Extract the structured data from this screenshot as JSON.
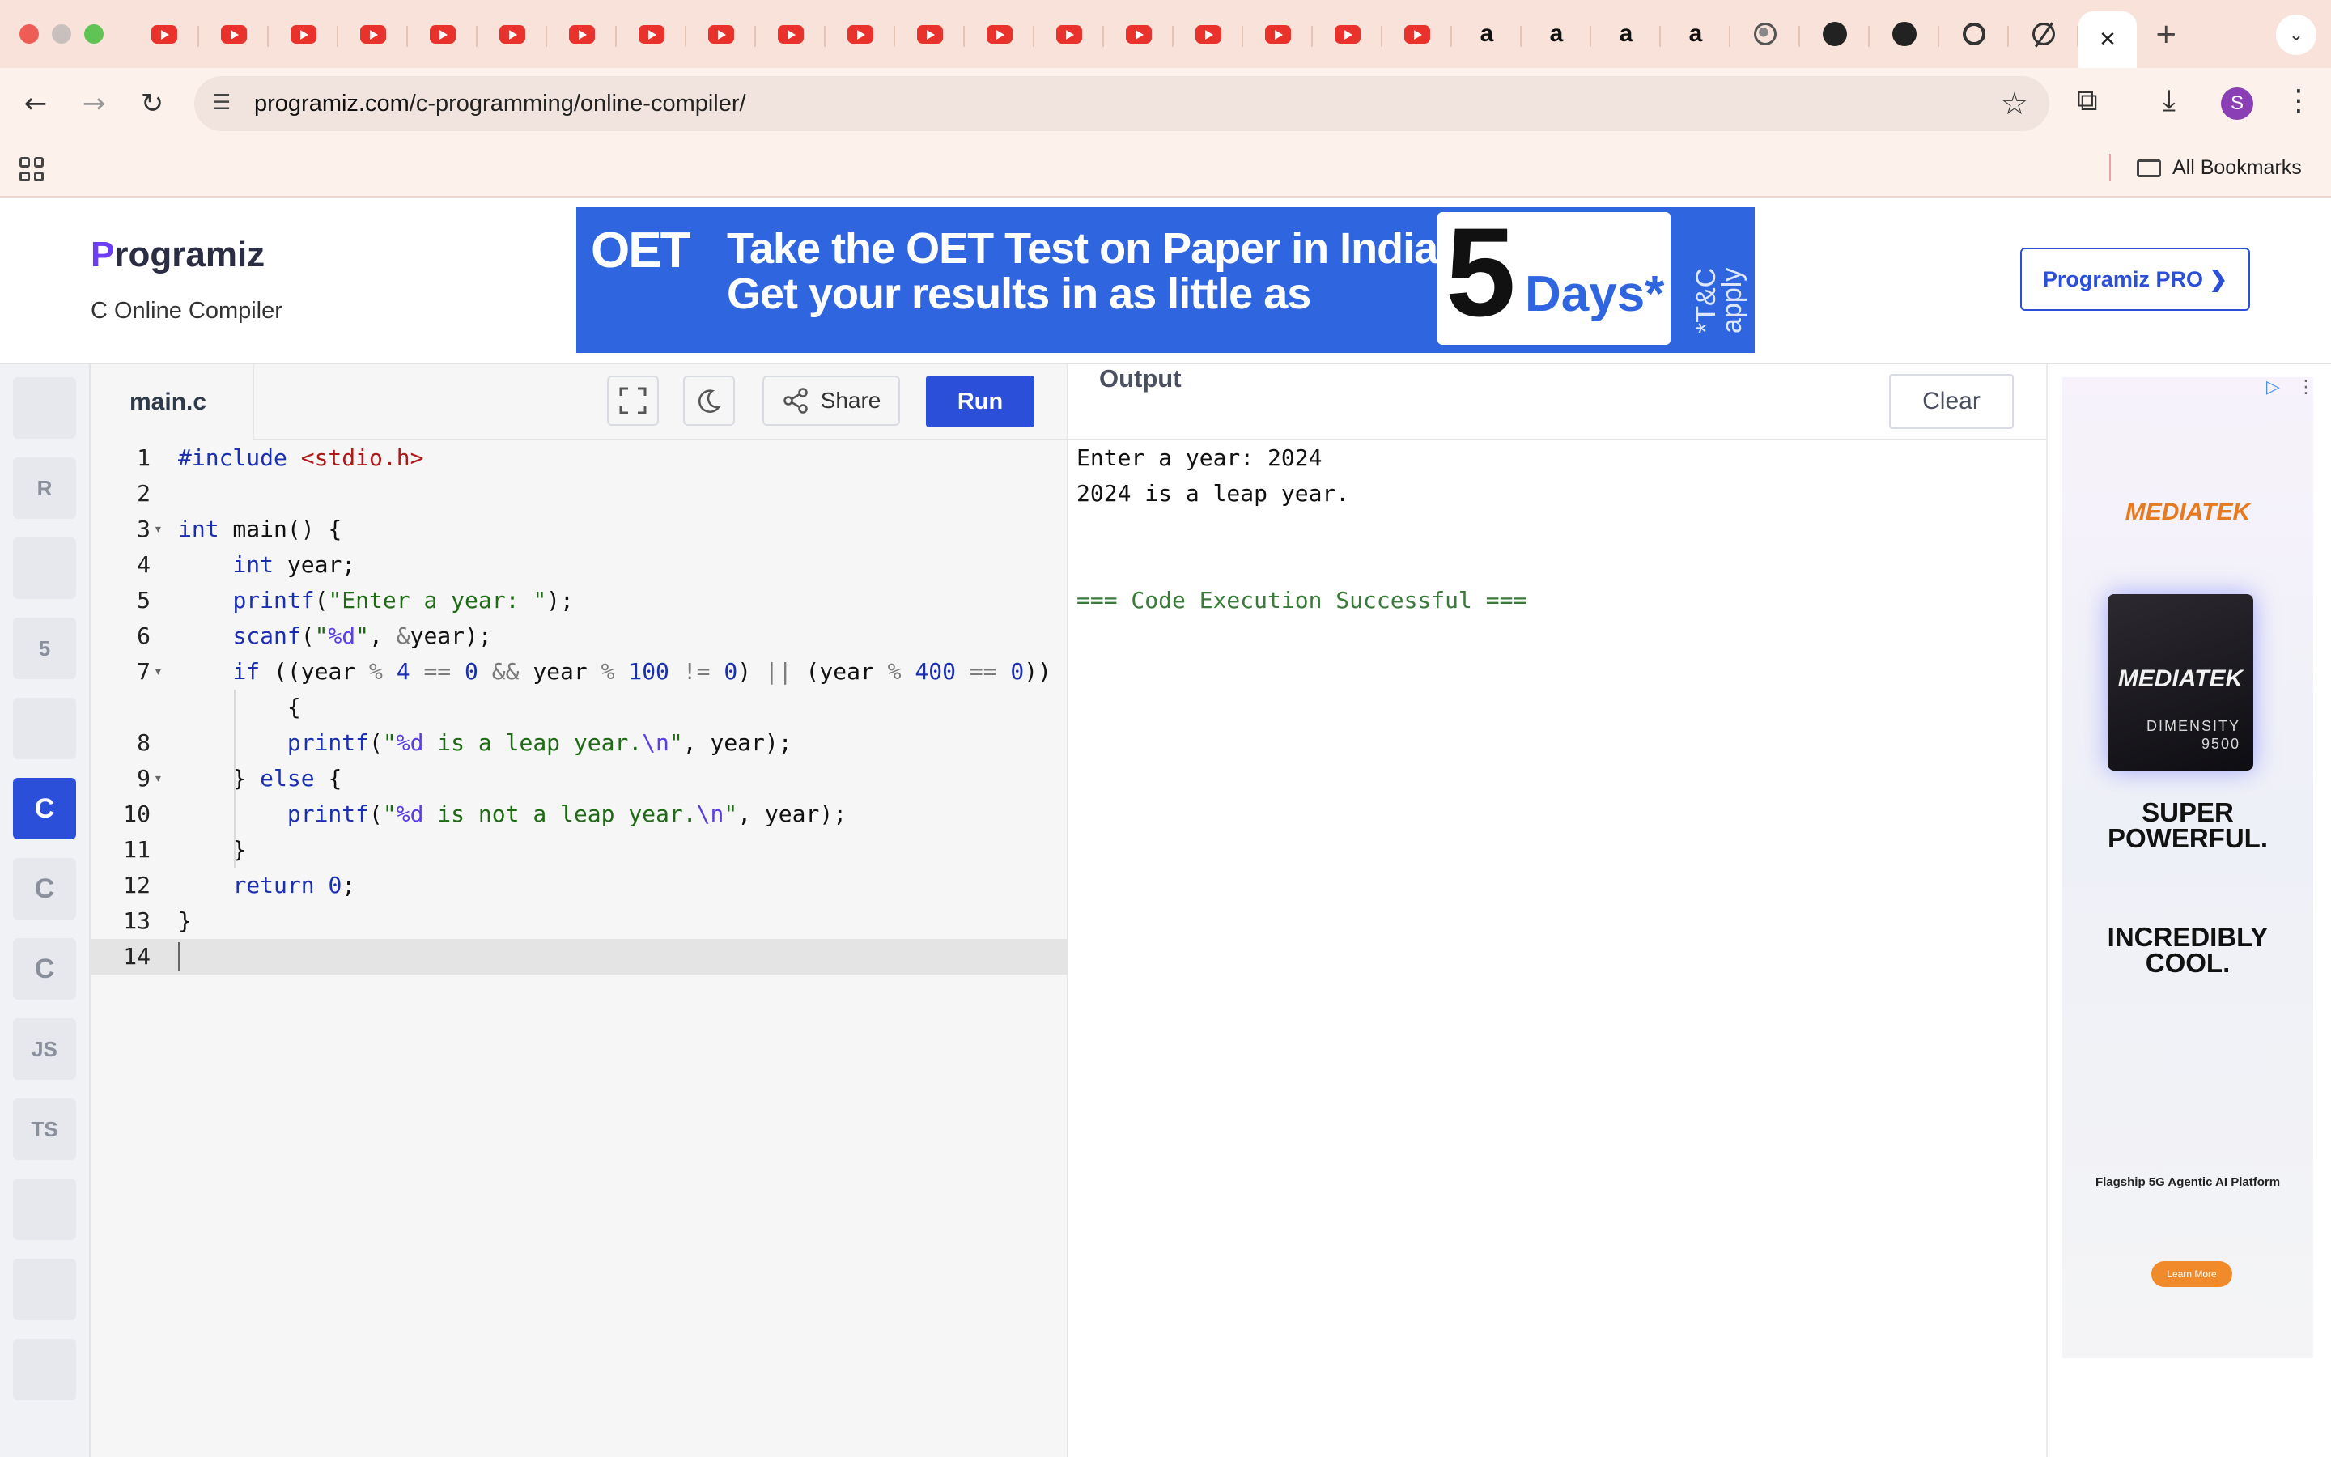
{
  "browser": {
    "tabs": [
      {
        "icon": "youtube-icon"
      },
      {
        "icon": "youtube-icon"
      },
      {
        "icon": "youtube-icon"
      },
      {
        "icon": "youtube-icon"
      },
      {
        "icon": "youtube-icon"
      },
      {
        "icon": "youtube-icon"
      },
      {
        "icon": "youtube-icon"
      },
      {
        "icon": "youtube-icon"
      },
      {
        "icon": "youtube-icon"
      },
      {
        "icon": "youtube-icon"
      },
      {
        "icon": "youtube-icon"
      },
      {
        "icon": "youtube-icon"
      },
      {
        "icon": "youtube-icon"
      },
      {
        "icon": "youtube-icon"
      },
      {
        "icon": "youtube-icon"
      },
      {
        "icon": "youtube-icon"
      },
      {
        "icon": "youtube-icon"
      },
      {
        "icon": "youtube-icon"
      },
      {
        "icon": "youtube-icon"
      },
      {
        "icon": "amazon-icon",
        "label": "a"
      },
      {
        "icon": "amazon-icon",
        "label": "a"
      },
      {
        "icon": "amazon-icon",
        "label": "a"
      },
      {
        "icon": "amazon-icon",
        "label": "a"
      },
      {
        "icon": "globe-icon"
      },
      {
        "icon": "github-icon"
      },
      {
        "icon": "github-icon"
      },
      {
        "icon": "chatgpt-icon"
      },
      {
        "icon": "perplexity-icon"
      }
    ],
    "active_tab_close": "✕",
    "new_tab": "+",
    "tab_menu": "⌄",
    "url_host": "programiz.com",
    "url_path": "/c-programming/online-compiler/",
    "back": "←",
    "forward": "→",
    "reload": "↻",
    "profile_initial": "S",
    "all_bookmarks": "All Bookmarks"
  },
  "header": {
    "logo_p": "P",
    "logo_rest": "rogramiz",
    "subtitle": "C Online Compiler",
    "pro_button": "Programiz PRO ❯"
  },
  "banner_ad": {
    "brand": "OET",
    "line1": "Take the OET Test on Paper in India.",
    "line2": "Get your results in as little as",
    "big_number": "5",
    "days": "Days*",
    "terms": "*T&C apply"
  },
  "languages": [
    {
      "name": "python",
      "label": ""
    },
    {
      "name": "r",
      "label": "R"
    },
    {
      "name": "sql",
      "label": ""
    },
    {
      "name": "html",
      "label": "5"
    },
    {
      "name": "java",
      "label": ""
    },
    {
      "name": "c",
      "label": "C",
      "active": true
    },
    {
      "name": "cpp",
      "label": "C"
    },
    {
      "name": "csharp",
      "label": "C"
    },
    {
      "name": "javascript",
      "label": "JS"
    },
    {
      "name": "typescript",
      "label": "TS"
    },
    {
      "name": "go",
      "label": ""
    },
    {
      "name": "swift",
      "label": ""
    },
    {
      "name": "rust",
      "label": ""
    }
  ],
  "editor": {
    "filename": "main.c",
    "share_label": "Share",
    "run_label": "Run",
    "lines": [
      {
        "n": "1",
        "fold": false
      },
      {
        "n": "2",
        "fold": false
      },
      {
        "n": "3",
        "fold": true
      },
      {
        "n": "4",
        "fold": false
      },
      {
        "n": "5",
        "fold": false
      },
      {
        "n": "6",
        "fold": false
      },
      {
        "n": "7",
        "fold": true
      },
      {
        "n": "",
        "fold": false
      },
      {
        "n": "8",
        "fold": false
      },
      {
        "n": "9",
        "fold": true
      },
      {
        "n": "10",
        "fold": false
      },
      {
        "n": "11",
        "fold": false
      },
      {
        "n": "12",
        "fold": false
      },
      {
        "n": "13",
        "fold": false
      },
      {
        "n": "14",
        "fold": false,
        "current": true
      }
    ],
    "code_tokens": [
      [
        [
          "k",
          "#include "
        ],
        [
          "inc",
          "<stdio.h>"
        ]
      ],
      [],
      [
        [
          "k",
          "int"
        ],
        [
          "t",
          " main() {"
        ]
      ],
      [
        [
          "t",
          "    "
        ],
        [
          "k",
          "int"
        ],
        [
          "t",
          " year;"
        ]
      ],
      [
        [
          "t",
          "    "
        ],
        [
          "k",
          "printf"
        ],
        [
          "t",
          "("
        ],
        [
          "s",
          "\"Enter a year: \""
        ],
        [
          "t",
          ");"
        ]
      ],
      [
        [
          "t",
          "    "
        ],
        [
          "k",
          "scanf"
        ],
        [
          "t",
          "("
        ],
        [
          "s",
          "\""
        ],
        [
          "e",
          "%d"
        ],
        [
          "s",
          "\""
        ],
        [
          "t",
          ", "
        ],
        [
          "op",
          "&"
        ],
        [
          "t",
          "year);"
        ]
      ],
      [
        [
          "t",
          "    "
        ],
        [
          "k",
          "if"
        ],
        [
          "t",
          " ((year "
        ],
        [
          "op",
          "%"
        ],
        [
          "t",
          " "
        ],
        [
          "num",
          "4"
        ],
        [
          "t",
          " "
        ],
        [
          "op",
          "=="
        ],
        [
          "t",
          " "
        ],
        [
          "num",
          "0"
        ],
        [
          "t",
          " "
        ],
        [
          "op",
          "&&"
        ],
        [
          "t",
          " year "
        ],
        [
          "op",
          "%"
        ],
        [
          "t",
          " "
        ],
        [
          "num",
          "100"
        ],
        [
          "t",
          " "
        ],
        [
          "op",
          "!="
        ],
        [
          "t",
          " "
        ],
        [
          "num",
          "0"
        ],
        [
          "t",
          ") "
        ],
        [
          "op",
          "||"
        ],
        [
          "t",
          " (year "
        ],
        [
          "op",
          "%"
        ],
        [
          "t",
          " "
        ],
        [
          "num",
          "400"
        ],
        [
          "t",
          " "
        ],
        [
          "op",
          "=="
        ],
        [
          "t",
          " "
        ],
        [
          "num",
          "0"
        ],
        [
          "t",
          "))"
        ]
      ],
      [
        [
          "t",
          "        {"
        ]
      ],
      [
        [
          "t",
          "        "
        ],
        [
          "k",
          "printf"
        ],
        [
          "t",
          "("
        ],
        [
          "s",
          "\""
        ],
        [
          "e",
          "%d"
        ],
        [
          "s",
          " is a leap year."
        ],
        [
          "e",
          "\\n"
        ],
        [
          "s",
          "\""
        ],
        [
          "t",
          ", year);"
        ]
      ],
      [
        [
          "t",
          "    } "
        ],
        [
          "k",
          "else"
        ],
        [
          "t",
          " {"
        ]
      ],
      [
        [
          "t",
          "        "
        ],
        [
          "k",
          "printf"
        ],
        [
          "t",
          "("
        ],
        [
          "s",
          "\""
        ],
        [
          "e",
          "%d"
        ],
        [
          "s",
          " is not a leap year."
        ],
        [
          "e",
          "\\n"
        ],
        [
          "s",
          "\""
        ],
        [
          "t",
          ", year);"
        ]
      ],
      [
        [
          "t",
          "    }"
        ]
      ],
      [
        [
          "t",
          "    "
        ],
        [
          "k",
          "return"
        ],
        [
          "t",
          " "
        ],
        [
          "num",
          "0"
        ],
        [
          "t",
          ";"
        ]
      ],
      [
        [
          "t",
          "}"
        ]
      ],
      []
    ]
  },
  "output": {
    "title": "Output",
    "clear_label": "Clear",
    "lines": [
      {
        "text": "Enter a year: 2024",
        "ok": false
      },
      {
        "text": "2024 is a leap year.",
        "ok": false
      },
      {
        "text": "",
        "ok": false
      },
      {
        "text": "",
        "ok": false
      },
      {
        "text": "=== Code Execution Successful ===",
        "ok": true
      }
    ]
  },
  "side_ad": {
    "brand_top": "MEDIATEK",
    "chip_brand": "MEDIATEK",
    "chip_model_1": "DIMENSITY",
    "chip_model_2": "9500",
    "headline1a": "SUPER",
    "headline1b": "POWERFUL.",
    "headline2a": "INCREDIBLY",
    "headline2b": "COOL.",
    "tagline": "Flagship 5G Agentic AI Platform",
    "cta": "Learn More"
  },
  "colors": {
    "accent": "#2b4fd8",
    "tabstrip": "#f9e2d9",
    "youtube": "#e8322b",
    "success": "#3a7a3a"
  }
}
